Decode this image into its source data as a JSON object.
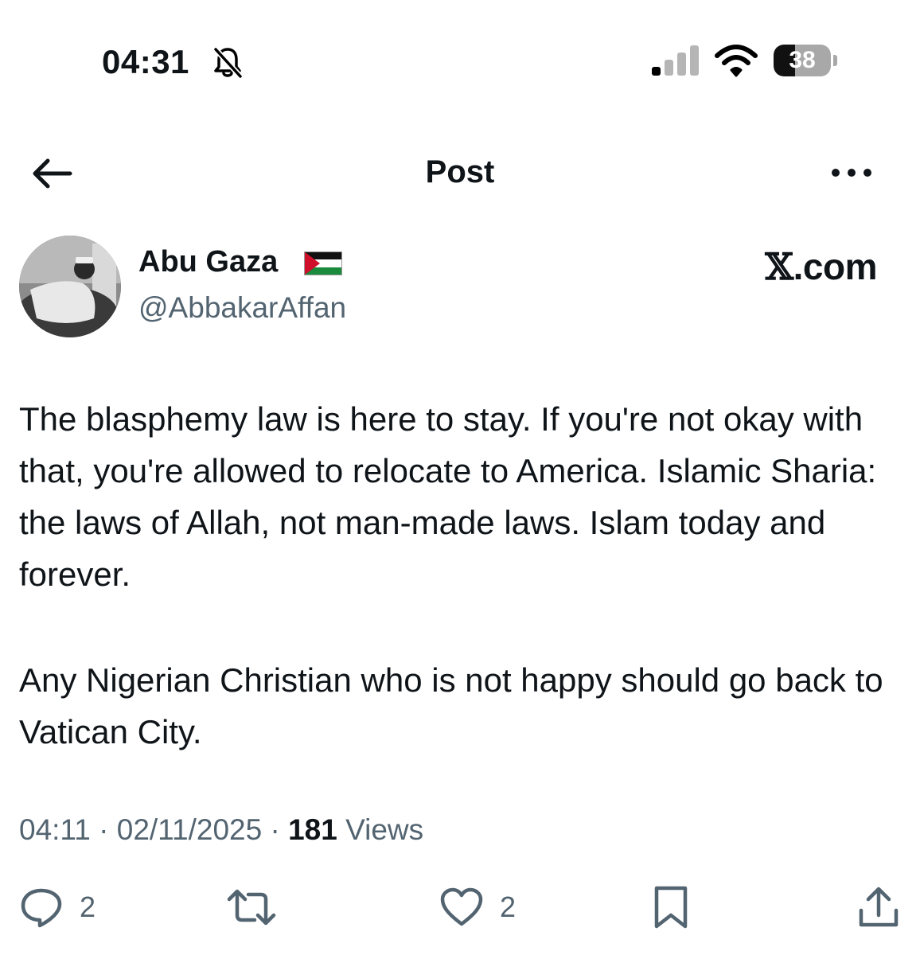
{
  "status_bar": {
    "time": "04:31",
    "battery_level": "38",
    "battery_fraction": 0.38,
    "icons": [
      "bell-slash-icon",
      "signal-icon",
      "wifi-icon",
      "battery-icon"
    ]
  },
  "nav": {
    "title": "Post",
    "back_icon": "arrow-left-icon",
    "more_icon": "more-horizontal-icon"
  },
  "post": {
    "author_name": "Abu Gaza",
    "author_flag": "🇵🇸",
    "author_handle": "@AbbakarAffan",
    "source_brand": "𝕏",
    "source_suffix": ".com",
    "paragraphs": [
      "The blasphemy law is here to stay. If you're not okay with that, you're allowed to relocate to America. Islamic Sharia: the laws of Allah, not man-made laws. Islam today and forever.",
      "Any Nigerian Christian who is not happy should go back to Vatican City."
    ],
    "time": "04:11",
    "separator": "·",
    "date": "02/11/2025",
    "views_count": "181",
    "views_label": "Views"
  },
  "actions": {
    "reply_count": "2",
    "repost_count": "",
    "like_count": "2"
  },
  "colors": {
    "text": "#0f1419",
    "secondary": "#536471",
    "background": "#ffffff"
  }
}
